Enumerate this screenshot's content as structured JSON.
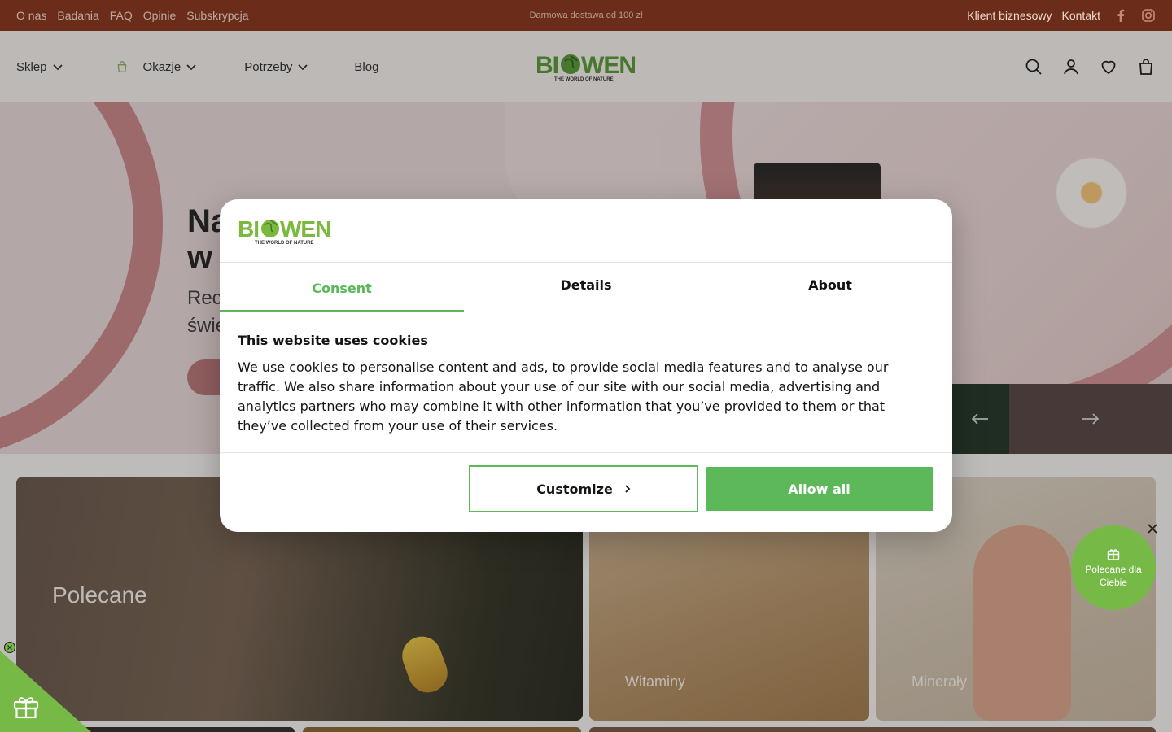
{
  "topbar": {
    "links": [
      "O nas",
      "Badania",
      "FAQ",
      "Opinie",
      "Subskrypcja"
    ],
    "promo": "Darmowa dostawa od 100 zł",
    "right_links": [
      "Klient biznesowy",
      "Kontakt"
    ],
    "social_icons": [
      "facebook-icon",
      "instagram-icon"
    ]
  },
  "header": {
    "nav": [
      "Sklep",
      "Okazje",
      "Potrzeby",
      "Blog"
    ],
    "logo_text": "BIOWEN",
    "logo_tagline": "THE WORLD OF NATURE",
    "icons": [
      "search-icon",
      "account-icon",
      "heart-icon",
      "cart-icon"
    ]
  },
  "hero": {
    "title_line1": "Na",
    "title_line2": "w",
    "subtitle_line1": "Rec",
    "subtitle_line2": "świe"
  },
  "tiles": {
    "polecane": "Polecane",
    "witaminy": "Witaminy",
    "mineraly": "Minerały"
  },
  "cookie_modal": {
    "logo_text": "BIOWEN",
    "logo_tagline": "THE WORLD OF NATURE",
    "tabs": [
      "Consent",
      "Details",
      "About"
    ],
    "active_tab": "Consent",
    "heading": "This website uses cookies",
    "body": "We use cookies to personalise content and ads, to provide social media features and to analyse our traffic. We also share information about your use of our site with our social media, advertising and analytics partners who may combine it with other information that you’ve provided to them or that they’ve collected from your use of their services.",
    "customize_label": "Customize",
    "allow_all_label": "Allow all"
  },
  "widgets": {
    "recommended_label": "Polecane dla Ciebie"
  },
  "colors": {
    "brand_green": "#5db85a",
    "topbar_brown": "#8a3a20",
    "logo_green": "#5a9a3a"
  }
}
